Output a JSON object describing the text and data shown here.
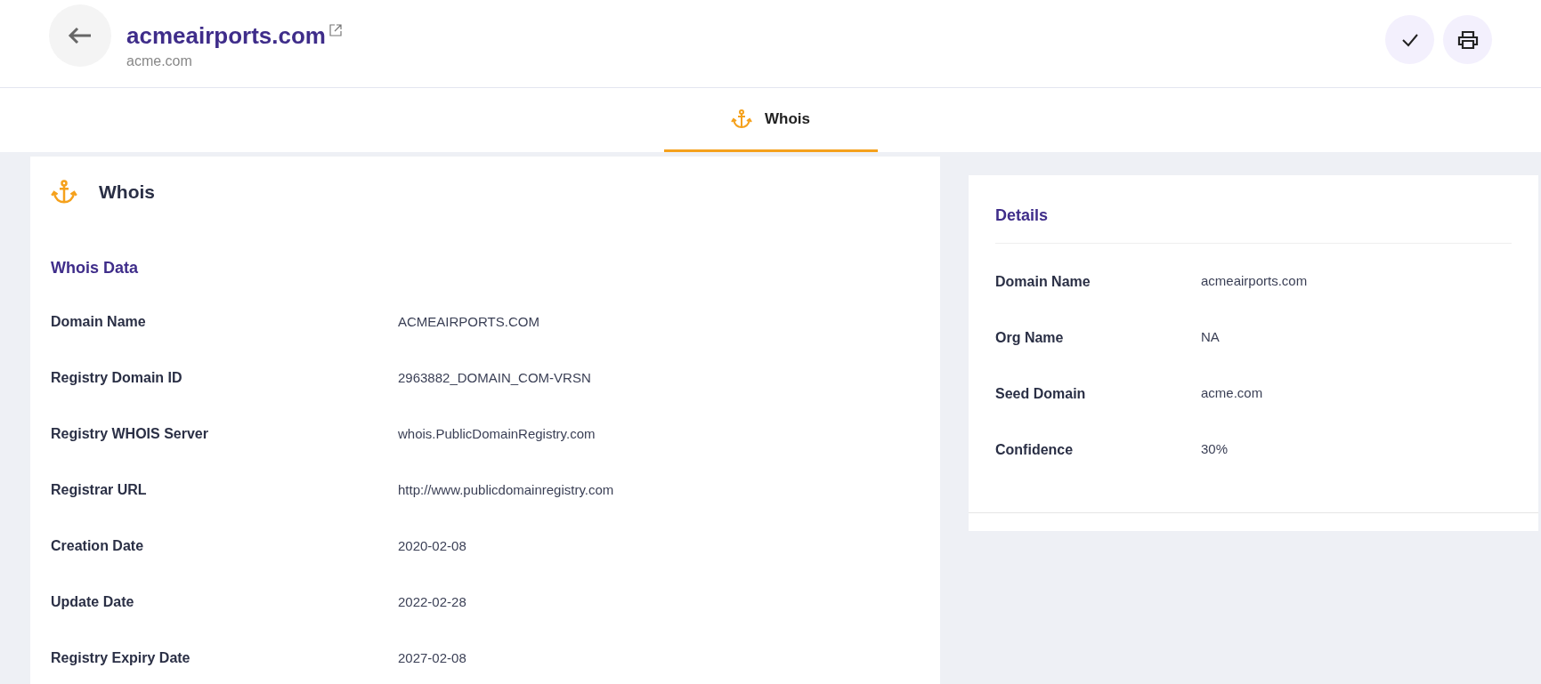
{
  "header": {
    "title": "acmeairports.com",
    "subtitle": "acme.com"
  },
  "tabs": [
    {
      "label": "Whois",
      "selected": true
    }
  ],
  "whois_card": {
    "title": "Whois",
    "section_title": "Whois Data",
    "rows": [
      {
        "label": "Domain Name",
        "value": "ACMEAIRPORTS.COM"
      },
      {
        "label": "Registry Domain ID",
        "value": "2963882_DOMAIN_COM-VRSN"
      },
      {
        "label": "Registry WHOIS Server",
        "value": "whois.PublicDomainRegistry.com"
      },
      {
        "label": "Registrar URL",
        "value": "http://www.publicdomainregistry.com"
      },
      {
        "label": "Creation Date",
        "value": "2020-02-08"
      },
      {
        "label": "Update Date",
        "value": "2022-02-28"
      },
      {
        "label": "Registry Expiry Date",
        "value": "2027-02-08"
      }
    ]
  },
  "details_card": {
    "title": "Details",
    "rows": [
      {
        "label": "Domain Name",
        "value": "acmeairports.com"
      },
      {
        "label": "Org Name",
        "value": "NA"
      },
      {
        "label": "Seed Domain",
        "value": "acme.com"
      },
      {
        "label": "Confidence",
        "value": "30%"
      }
    ]
  }
}
